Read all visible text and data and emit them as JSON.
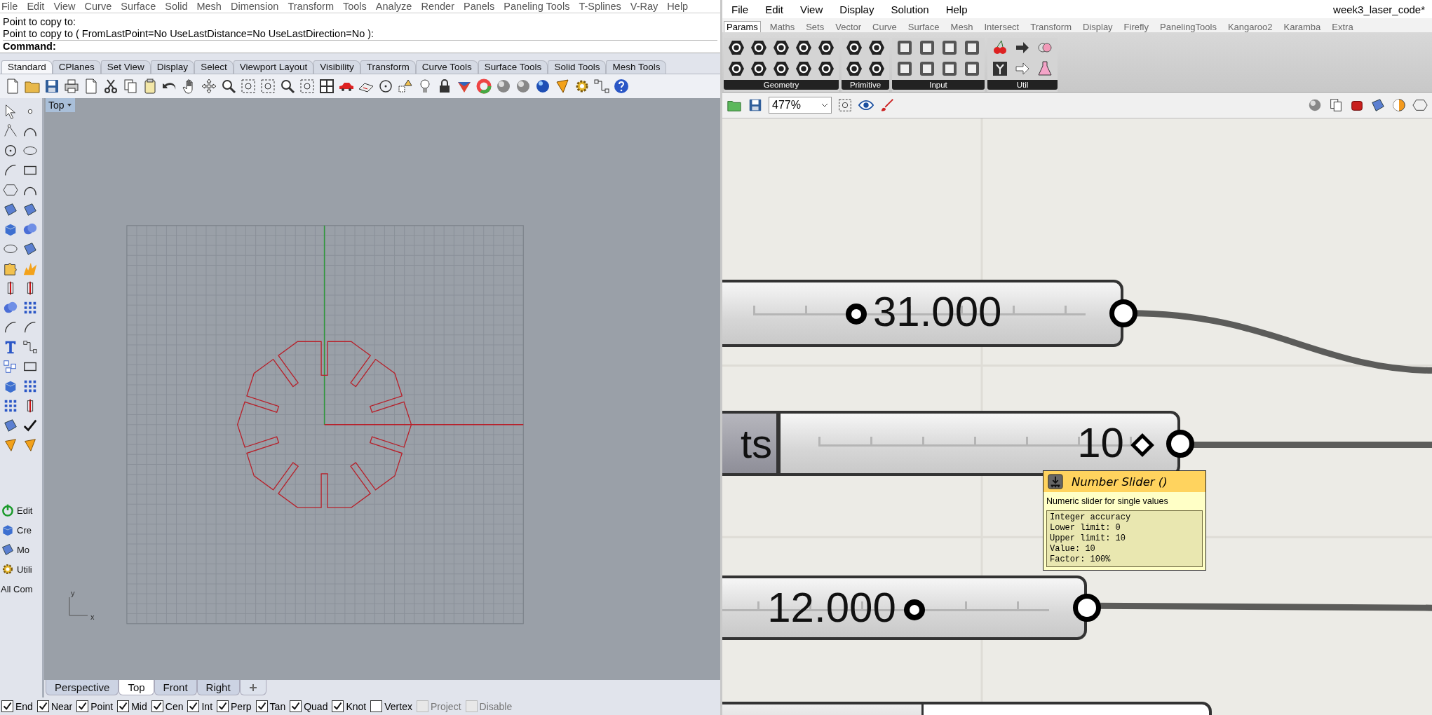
{
  "rhino": {
    "menu": [
      "File",
      "Edit",
      "View",
      "Curve",
      "Surface",
      "Solid",
      "Mesh",
      "Dimension",
      "Transform",
      "Tools",
      "Analyze",
      "Render",
      "Panels",
      "Paneling Tools",
      "T-Splines",
      "V-Ray",
      "Help"
    ],
    "command_history": [
      "Point to copy to:",
      "Point to copy to ( FromLastPoint=No  UseLastDistance=No  UseLastDirection=No ):"
    ],
    "command_prompt": "Command:",
    "toolbar_tabs": [
      {
        "label": "Standard",
        "selected": true
      },
      {
        "label": "CPlanes",
        "selected": false
      },
      {
        "label": "Set View",
        "selected": false
      },
      {
        "label": "Display",
        "selected": false
      },
      {
        "label": "Select",
        "selected": false
      },
      {
        "label": "Viewport Layout",
        "selected": false
      },
      {
        "label": "Visibility",
        "selected": false
      },
      {
        "label": "Transform",
        "selected": false
      },
      {
        "label": "Curve Tools",
        "selected": false
      },
      {
        "label": "Surface Tools",
        "selected": false
      },
      {
        "label": "Solid Tools",
        "selected": false
      },
      {
        "label": "Mesh Tools",
        "selected": false
      }
    ],
    "side_buttons": [
      "Edit",
      "Cre",
      "Mo",
      "Utili",
      "All Com"
    ],
    "viewport": {
      "title": "Top",
      "axis_x": "x",
      "axis_y": "y"
    },
    "viewport_tabs": [
      {
        "label": "Perspective",
        "selected": false
      },
      {
        "label": "Top",
        "selected": true
      },
      {
        "label": "Front",
        "selected": false
      },
      {
        "label": "Right",
        "selected": false
      }
    ],
    "osnaps": [
      {
        "label": "End",
        "checked": true,
        "disabled": false
      },
      {
        "label": "Near",
        "checked": true,
        "disabled": false
      },
      {
        "label": "Point",
        "checked": true,
        "disabled": false
      },
      {
        "label": "Mid",
        "checked": true,
        "disabled": false
      },
      {
        "label": "Cen",
        "checked": true,
        "disabled": false
      },
      {
        "label": "Int",
        "checked": true,
        "disabled": false
      },
      {
        "label": "Perp",
        "checked": true,
        "disabled": false
      },
      {
        "label": "Tan",
        "checked": true,
        "disabled": false
      },
      {
        "label": "Quad",
        "checked": true,
        "disabled": false
      },
      {
        "label": "Knot",
        "checked": true,
        "disabled": false
      },
      {
        "label": "Vertex",
        "checked": false,
        "disabled": false
      },
      {
        "label": "Project",
        "checked": false,
        "disabled": true
      },
      {
        "label": "Disable",
        "checked": false,
        "disabled": true
      }
    ]
  },
  "grasshopper": {
    "menu": [
      "File",
      "Edit",
      "View",
      "Display",
      "Solution",
      "Help"
    ],
    "document_title": "week3_laser_code*",
    "tabs": [
      {
        "label": "Params",
        "selected": true
      },
      {
        "label": "Maths",
        "selected": false
      },
      {
        "label": "Sets",
        "selected": false
      },
      {
        "label": "Vector",
        "selected": false
      },
      {
        "label": "Curve",
        "selected": false
      },
      {
        "label": "Surface",
        "selected": false
      },
      {
        "label": "Mesh",
        "selected": false
      },
      {
        "label": "Intersect",
        "selected": false
      },
      {
        "label": "Transform",
        "selected": false
      },
      {
        "label": "Display",
        "selected": false
      },
      {
        "label": "Firefly",
        "selected": false
      },
      {
        "label": "PanelingTools",
        "selected": false
      },
      {
        "label": "Kangaroo2",
        "selected": false
      },
      {
        "label": "Karamba",
        "selected": false
      },
      {
        "label": "Extra",
        "selected": false
      }
    ],
    "panel_groups": [
      "Geometry",
      "Primitive",
      "Input",
      "Util"
    ],
    "zoom": "477%",
    "sliders": [
      {
        "kind": "float",
        "value": "31.000",
        "level": 0.31
      },
      {
        "kind": "integer",
        "label": "ts",
        "value": "10",
        "level": 1.0
      },
      {
        "kind": "float",
        "value": "12.000",
        "level": 0.73
      }
    ],
    "tooltip": {
      "title": "Number Slider ()",
      "description": "Numeric slider for single values",
      "details": [
        "Integer accuracy",
        "Lower limit: 0",
        "Upper limit: 10",
        "Value: 10",
        "Factor: 100%"
      ]
    }
  }
}
